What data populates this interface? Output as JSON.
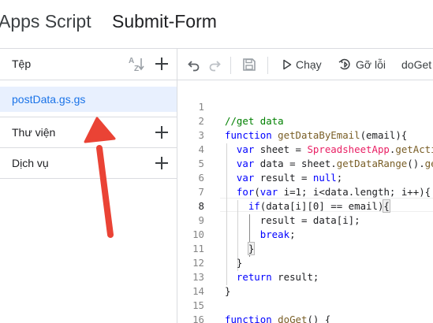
{
  "header": {
    "app_name": "Apps Script",
    "project_name": "Submit-Form"
  },
  "sidebar": {
    "files_label": "Tệp",
    "sort_icon": "sort-az-icon",
    "files": [
      {
        "name": "postData.gs.gs",
        "selected": true
      }
    ],
    "sections": [
      {
        "label": "Thư viện",
        "icon": "plus-icon"
      },
      {
        "label": "Dịch vụ",
        "icon": "plus-icon"
      }
    ]
  },
  "toolbar": {
    "undo_icon": "undo-icon",
    "redo_icon": "redo-icon",
    "save_icon": "save-icon",
    "run_label": "Chạy",
    "debug_label": "Gỡ lỗi",
    "function_select": "doGet"
  },
  "editor": {
    "active_line": 8,
    "lines": [
      {
        "n": "1"
      },
      {
        "n": "2"
      },
      {
        "n": "3"
      },
      {
        "n": "4"
      },
      {
        "n": "5"
      },
      {
        "n": "6"
      },
      {
        "n": "7"
      },
      {
        "n": "8"
      },
      {
        "n": "9"
      },
      {
        "n": "10"
      },
      {
        "n": "11"
      },
      {
        "n": "12"
      },
      {
        "n": "13"
      },
      {
        "n": "14"
      },
      {
        "n": "15"
      },
      {
        "n": "16"
      }
    ],
    "code": {
      "l2_comment": "//get data",
      "l3_kw": "function",
      "l3_fn": "getDataByEmail",
      "l3_rest": "(email){",
      "l4_kw": "var",
      "l4_a": " sheet = ",
      "l4_cls": "SpreadsheetApp",
      "l4_b": ".",
      "l4_fn": "getActiveSheet",
      "l4_c": "();",
      "l5_kw": "var",
      "l5_a": " data = sheet.",
      "l5_fn": "getDataRange",
      "l5_b": "().",
      "l5_fn2": "getValues",
      "l5_c": "();",
      "l6_kw": "var",
      "l6_a": " result = ",
      "l6_kw2": "null",
      "l6_b": ";",
      "l7_kw": "for",
      "l7_a": "(",
      "l7_kw2": "var",
      "l7_b": " i=1; i<data.length; i++){",
      "l8_kw": "if",
      "l8_a": "(data[i][0] == email)",
      "l8_brace": "{",
      "l9": "result = data[i];",
      "l10_kw": "break",
      "l10_a": ";",
      "l11_brace": "}",
      "l12": "}",
      "l13_kw": "return",
      "l13_a": " result;",
      "l14": "}",
      "l16_kw": "function",
      "l16_fn": "doGet",
      "l16_rest": "() {"
    }
  },
  "colors": {
    "accent": "#1a73e8",
    "selected_bg": "#e8f0fe",
    "keyword": "#0000ff",
    "comment": "#008000",
    "class_name": "#e91e63",
    "function_name": "#795e26",
    "arrow": "#ea4335"
  }
}
